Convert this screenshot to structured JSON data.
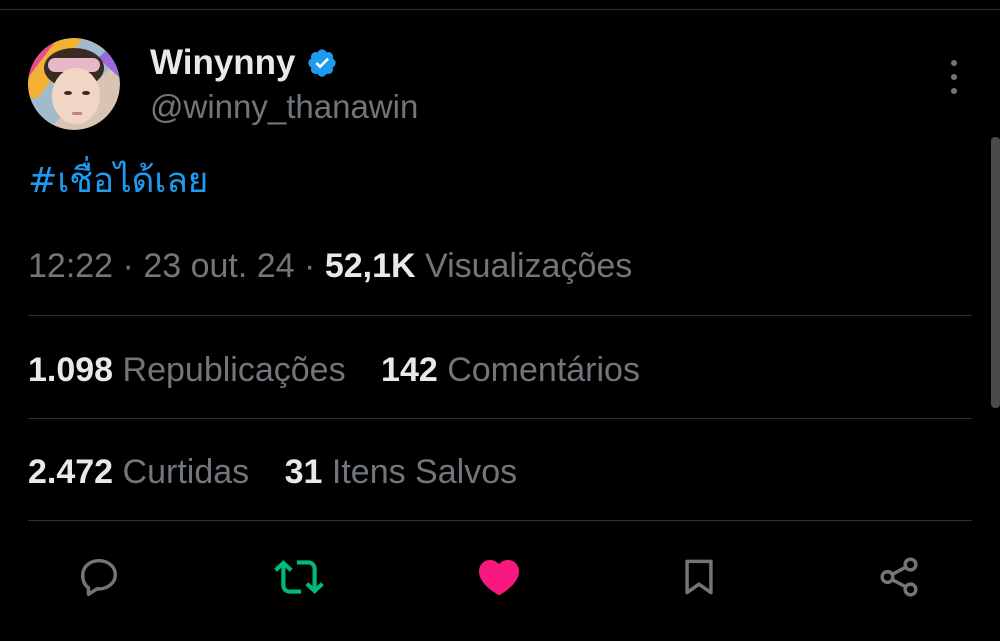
{
  "author": {
    "display_name": "Winynny",
    "handle": "@winny_thanawin",
    "verified": true
  },
  "tweet": {
    "text": "#เชื่อได้เลย"
  },
  "meta": {
    "time": "12:22",
    "separator": "·",
    "date": "23 out. 24",
    "views_count": "52,1K",
    "views_label": "Visualizações"
  },
  "stats": {
    "reposts_count": "1.098",
    "reposts_label": "Republicações",
    "comments_count": "142",
    "comments_label": "Comentários",
    "likes_count": "2.472",
    "likes_label": "Curtidas",
    "saves_count": "31",
    "saves_label": "Itens Salvos"
  },
  "actions": {
    "reply_icon": "reply-icon",
    "repost_icon": "repost-icon",
    "like_icon": "heart-icon",
    "bookmark_icon": "bookmark-icon",
    "share_icon": "share-icon"
  },
  "colors": {
    "background": "#000000",
    "text_primary": "#e7e9ea",
    "text_secondary": "#71767b",
    "link": "#1d9bf0",
    "verified": "#1d9bf0",
    "repost_active": "#00ba7c",
    "like_active": "#f91880",
    "divider": "#2f3336"
  }
}
